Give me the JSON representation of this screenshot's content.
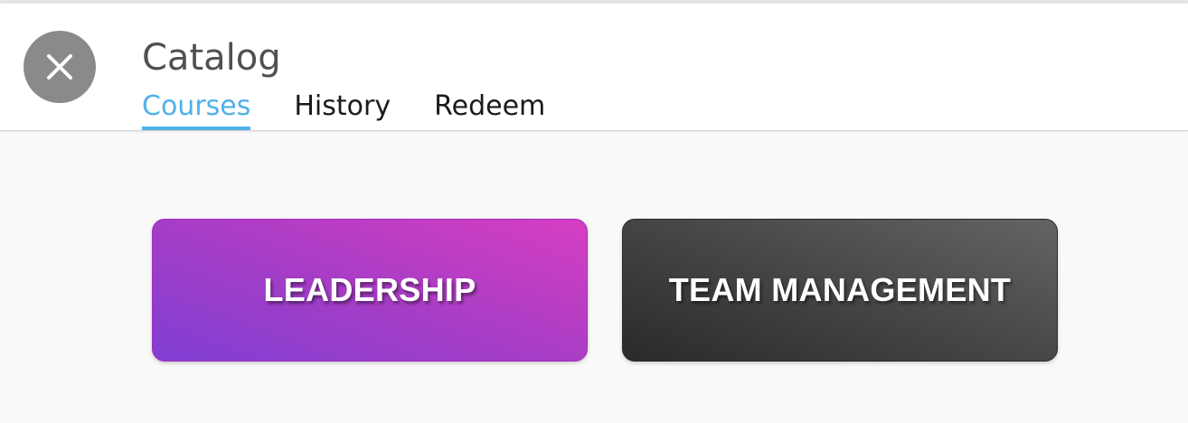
{
  "header": {
    "title": "Catalog",
    "close_icon": "close-icon",
    "tabs": [
      {
        "label": "Courses",
        "active": true
      },
      {
        "label": "History",
        "active": false
      },
      {
        "label": "Redeem",
        "active": false
      }
    ]
  },
  "cards": [
    {
      "label": "LEADERSHIP",
      "gradient": [
        "#7f3fd3",
        "#d63ec2"
      ]
    },
    {
      "label": "TEAM MANAGEMENT",
      "gradient": [
        "#2a2a2a",
        "#646466"
      ]
    }
  ],
  "colors": {
    "accent": "#4fb1ea",
    "close_button": "#8a8a8a",
    "background": "#f9f9f9"
  }
}
